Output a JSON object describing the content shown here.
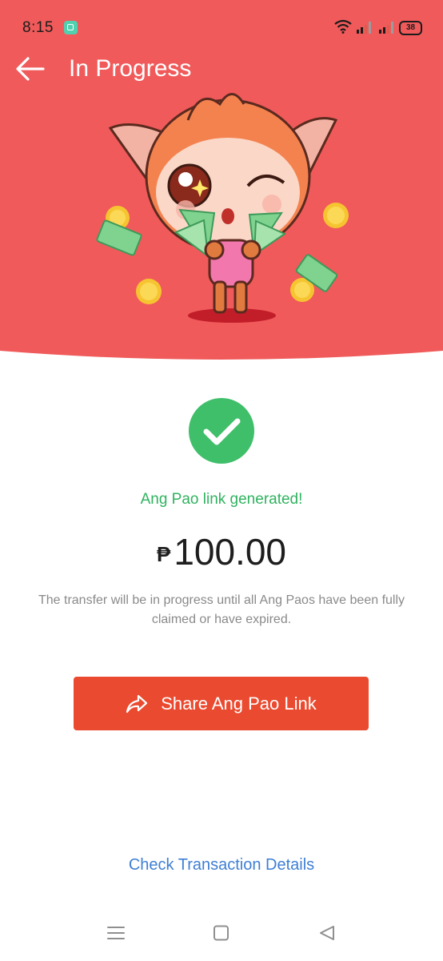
{
  "status_bar": {
    "time": "8:15",
    "battery": "38"
  },
  "header": {
    "title": "In Progress",
    "background_color": "#f05a5a"
  },
  "main": {
    "status_message": "Ang Pao link generated!",
    "currency_symbol": "₱",
    "amount": "100.00",
    "info_text": "The transfer will be in progress until all Ang Paos have been fully claimed or have expired.",
    "share_button_label": "Share Ang Pao Link",
    "details_link_label": "Check Transaction Details"
  },
  "colors": {
    "success": "#2fb35f",
    "primary_button": "#ea4a2f",
    "link": "#3f7fd4"
  }
}
